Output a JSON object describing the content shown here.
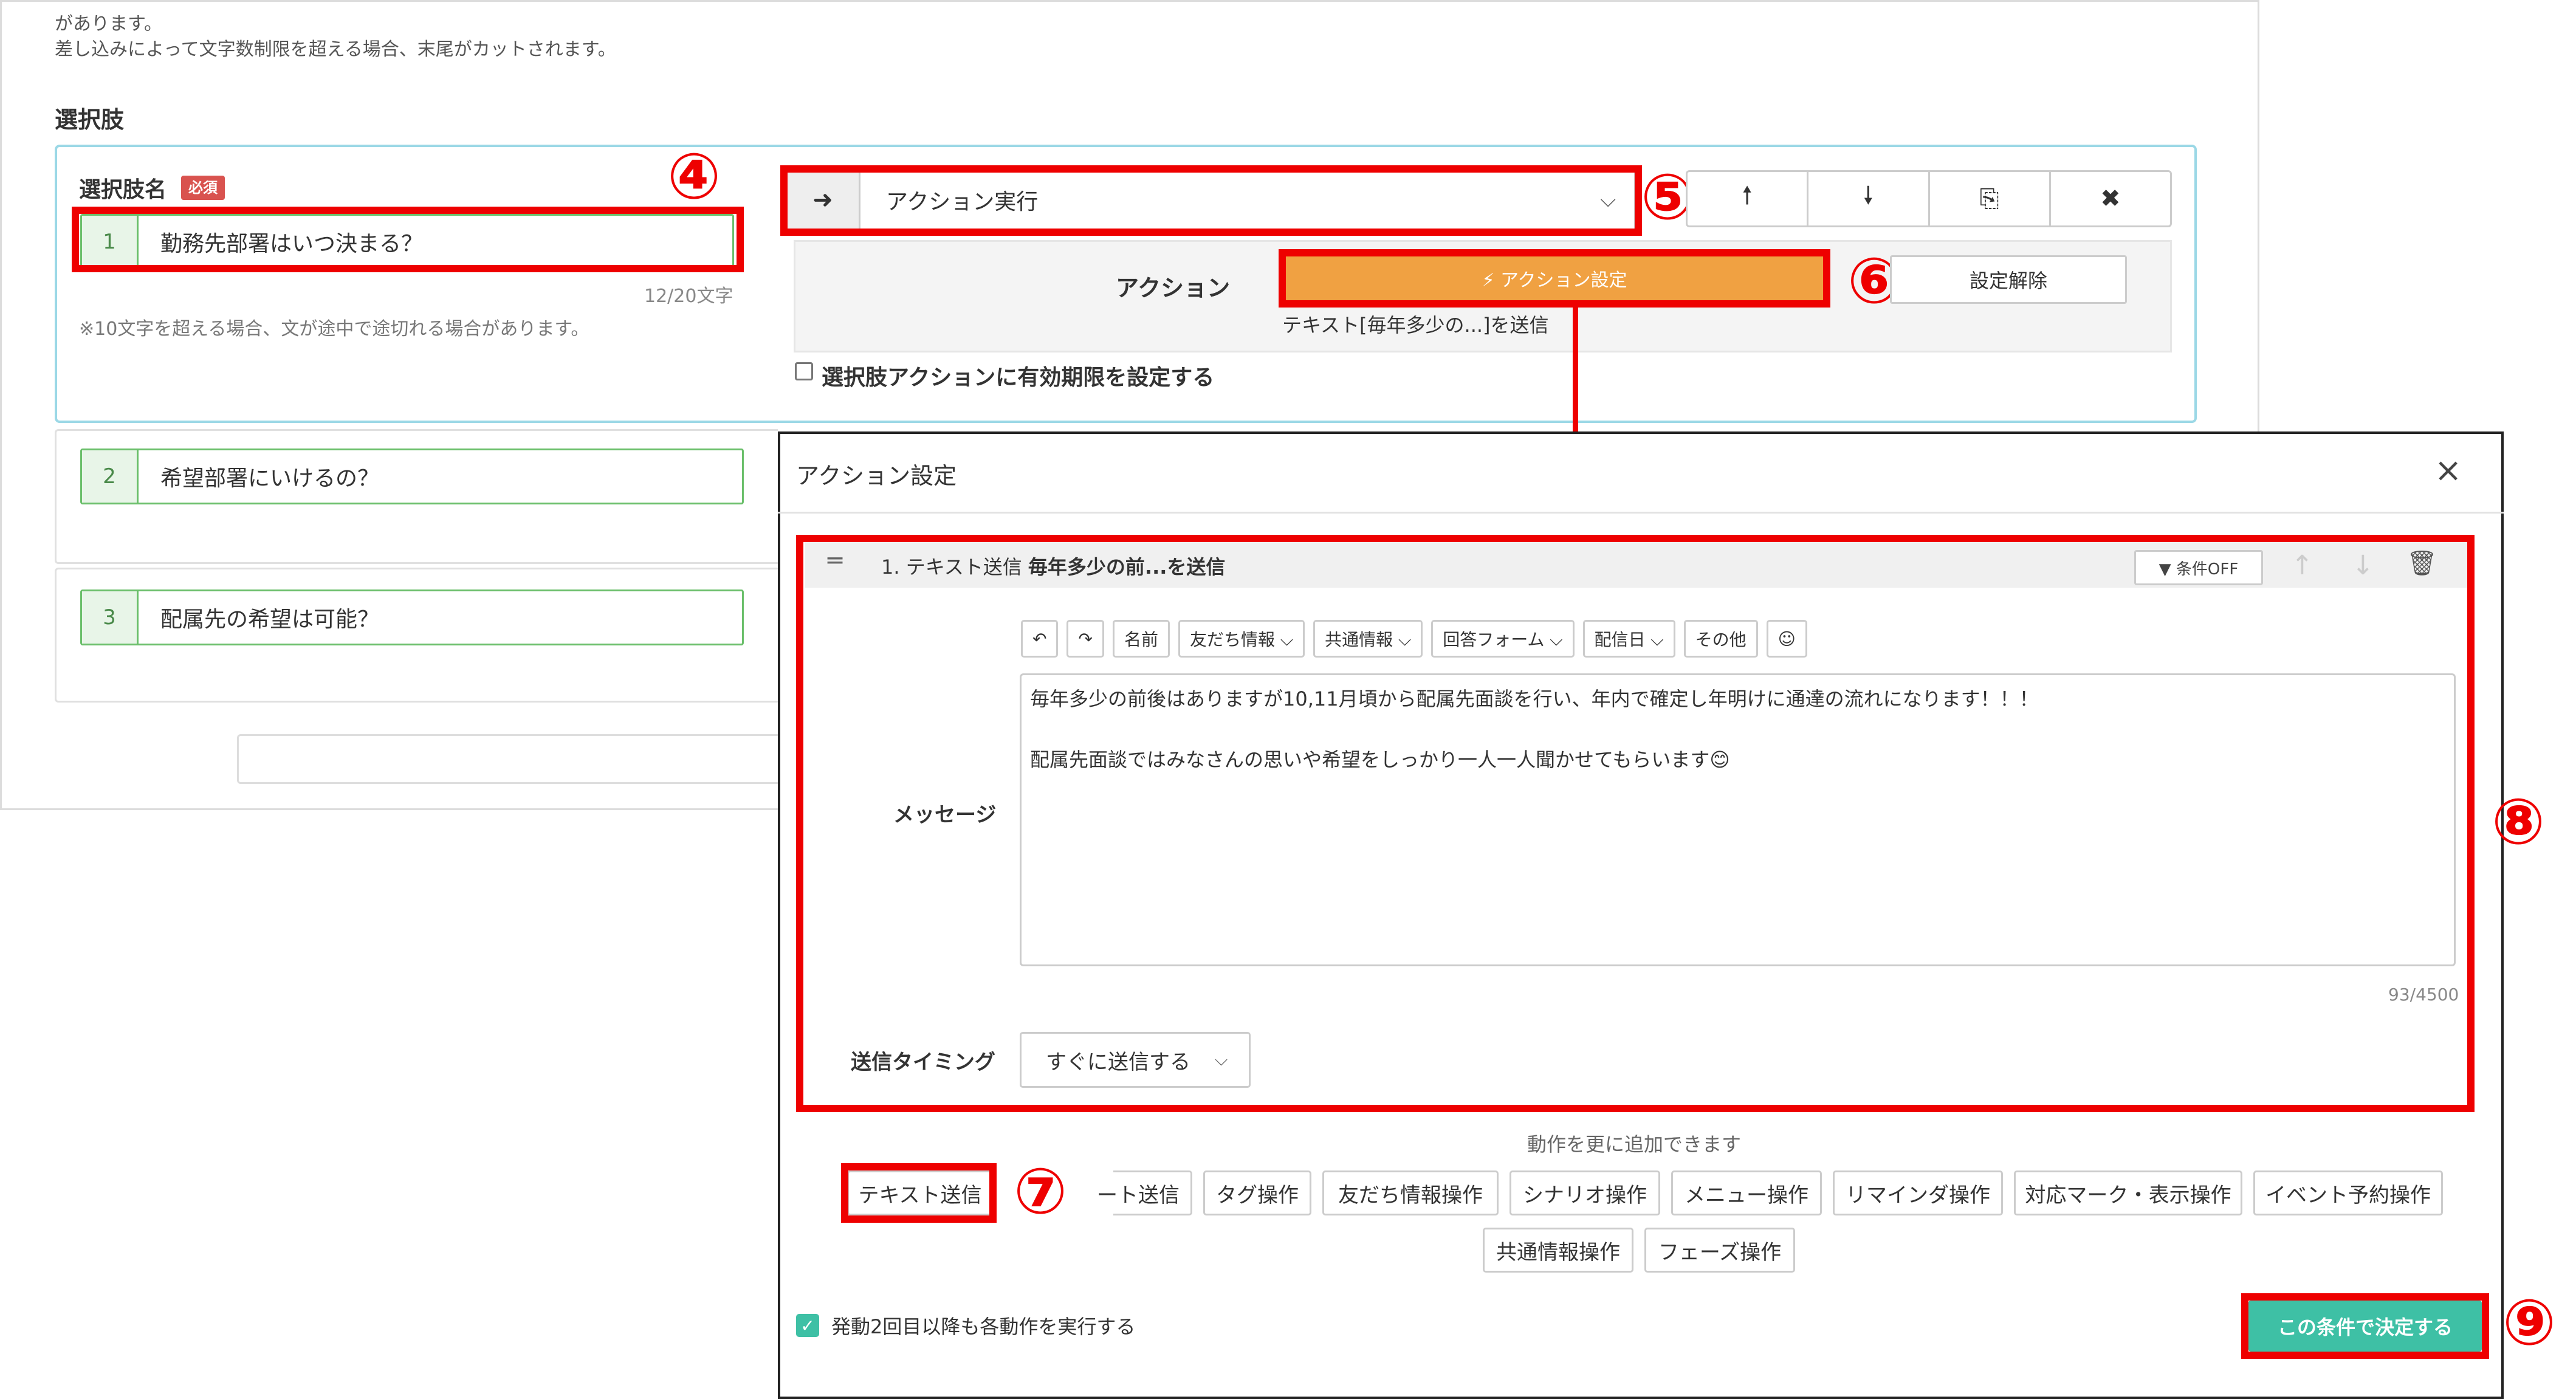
{
  "notes": {
    "line1": "があります。",
    "line2": "差し込みによって文字数制限を超える場合、末尾がカットされます。"
  },
  "section": {
    "title": "選択肢"
  },
  "choice_editor": {
    "label": "選択肢名",
    "required_badge": "必須",
    "active_choice": {
      "number": "1",
      "text": "勤務先部署はいつ決まる？"
    },
    "counter": "12/20文字",
    "hint": "※10文字を超える場合、文が途中で途切れる場合があります。",
    "select": {
      "arrow": "➜",
      "value": "アクション実行",
      "chevron": "⌵"
    },
    "buttons": {
      "up": "🠕",
      "down": "🠗",
      "copy": "⎘",
      "delete": "✖"
    },
    "action_label": "アクション",
    "action_button": "⚡ アクション設定",
    "release_button": "設定解除",
    "action_desc": "テキスト[毎年多少の...]を送信",
    "expiry_checkbox_label": "選択肢アクションに有効期限を設定する"
  },
  "other_choices": [
    {
      "number": "2",
      "text": "希望部署にいけるの？"
    },
    {
      "number": "3",
      "text": "配属先の希望は可能？"
    }
  ],
  "annotations": {
    "n4": "④",
    "n5": "⑤",
    "n6": "⑥",
    "n7": "⑦",
    "n8": "⑧",
    "n9": "⑨"
  },
  "modal": {
    "title": "アクション設定",
    "close": "×",
    "step": {
      "handle": "═",
      "title_prefix": "1. テキスト送信",
      "title_bold": "毎年多少の前...を送信",
      "cond_button": "▼ 条件OFF",
      "up": "↑",
      "down": "↓",
      "trash": "🗑"
    },
    "toolbar": [
      "↶",
      "↷",
      "名前",
      "友だち情報 ⌵",
      "共通情報 ⌵",
      "回答フォーム ⌵",
      "配信日 ⌵",
      "その他",
      "☺"
    ],
    "message_label": "メッセージ",
    "message_text": "毎年多少の前後はありますが10,11月頃から配属先面談を行い、年内で確定し年明けに通達の流れになります！！！\n\n配属先面談ではみなさんの思いや希望をしっかり一人一人聞かせてもらいます😊",
    "message_count": "93/4500",
    "timing_label": "送信タイミング",
    "timing_value": "すぐに送信する",
    "timing_chevron": "⌵",
    "add_hint": "動作を更に追加できます",
    "ops_row1": [
      "テキスト送信",
      "ート送信",
      "タグ操作",
      "友だち情報操作",
      "シナリオ操作",
      "メニュー操作",
      "リマインダ操作",
      "対応マーク・表示操作",
      "イベント予約操作"
    ],
    "ops_row2": [
      "共通情報操作",
      "フェーズ操作"
    ],
    "footer_check_label": "発動2回目以降も各動作を実行する",
    "footer_check_mark": "✓",
    "submit": "この条件で決定する"
  },
  "colors": {
    "accent_red": "#ee0000",
    "action_orange": "#f0a142",
    "submit_teal": "#3ec0a5",
    "choice_green": "#6bbf6b"
  }
}
